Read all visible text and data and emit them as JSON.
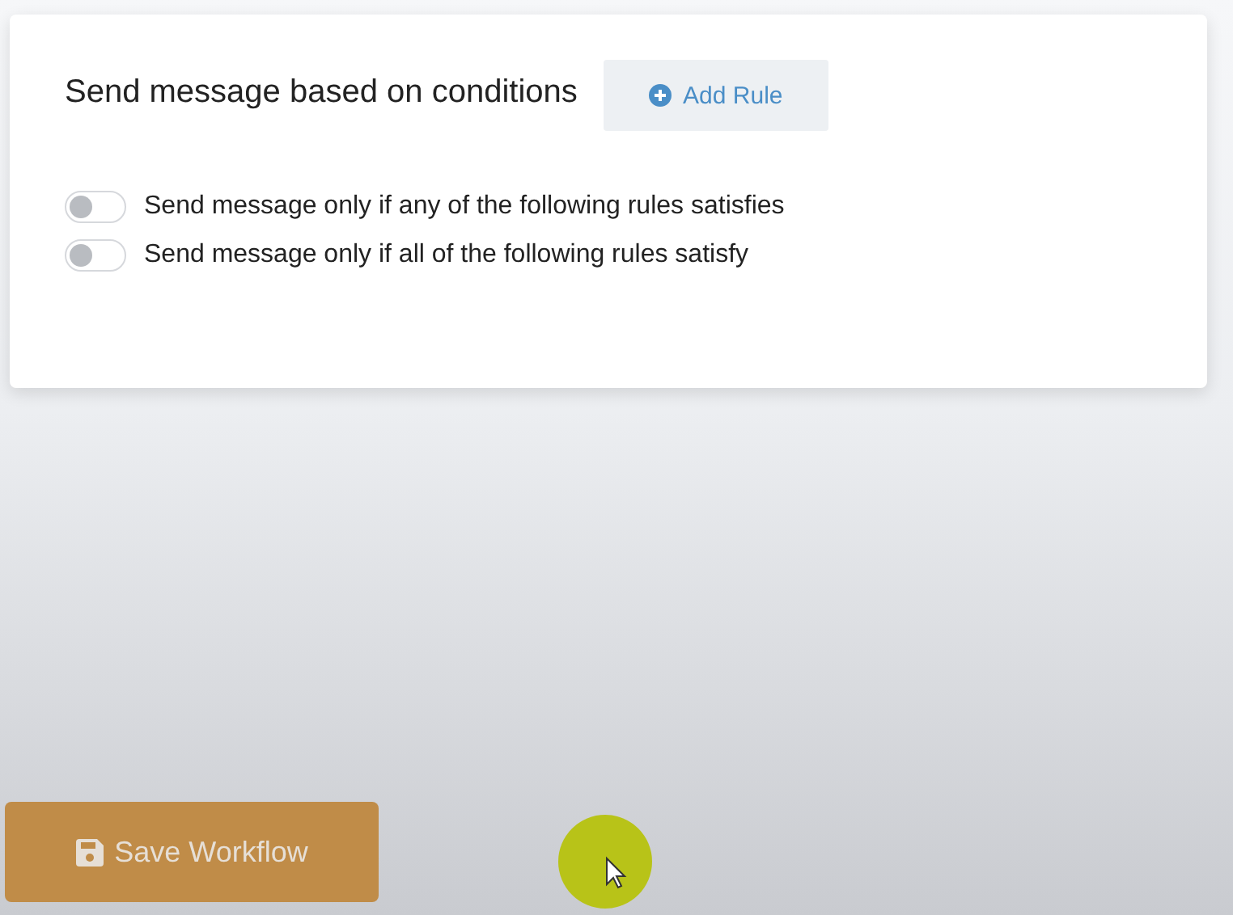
{
  "card": {
    "title": "Send message based on conditions",
    "add_button": {
      "label": "Add Rule"
    },
    "toggles": [
      {
        "label": "Send message only if any of the following rules satisfies",
        "on": false
      },
      {
        "label": "Send message only if all of the following rules satisfy",
        "on": false
      }
    ]
  },
  "save_button": {
    "label": "Save Workflow"
  }
}
